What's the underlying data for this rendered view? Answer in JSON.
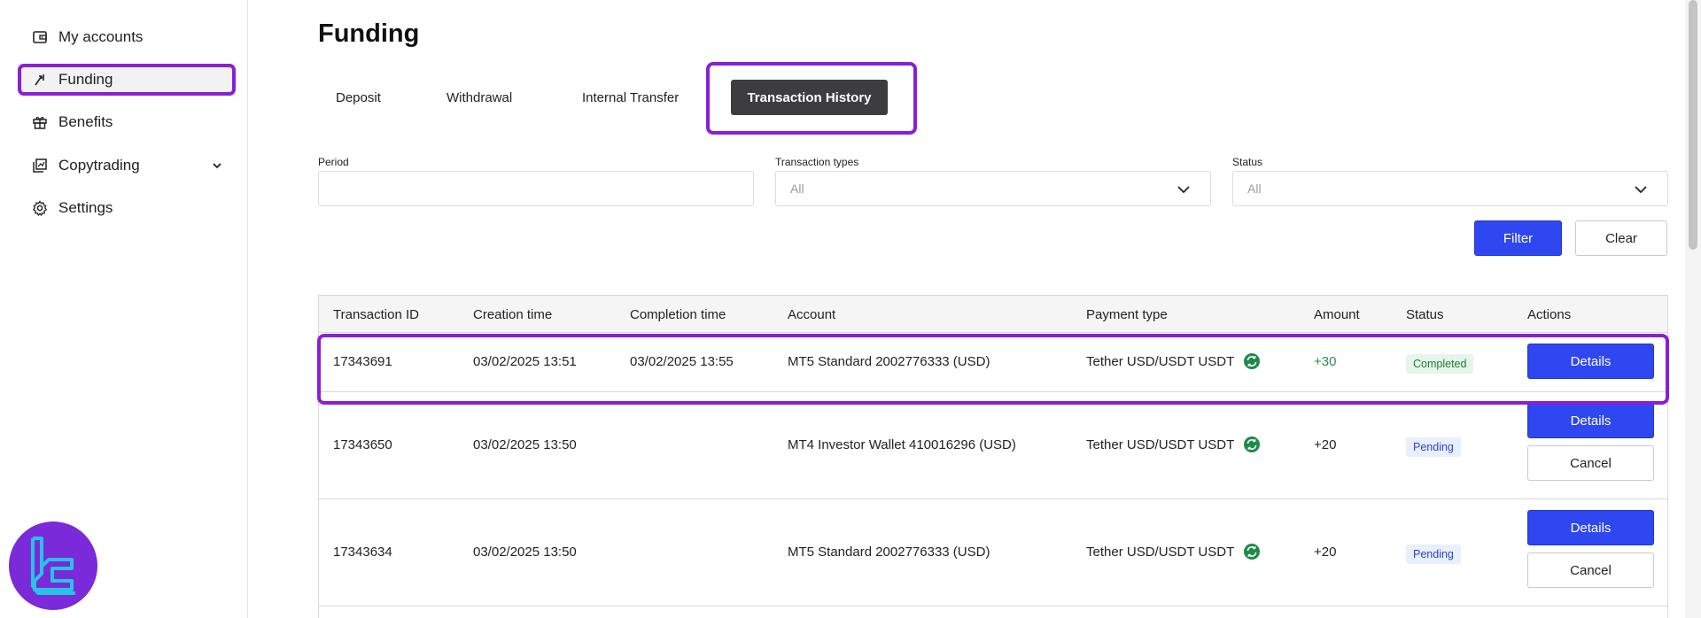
{
  "sidebar": {
    "items": [
      {
        "label": "My accounts",
        "icon": "wallet-icon"
      },
      {
        "label": "Funding",
        "icon": "funding-arrows-icon"
      },
      {
        "label": "Benefits",
        "icon": "gift-icon"
      },
      {
        "label": "Copytrading",
        "icon": "copy-icon"
      },
      {
        "label": "Settings",
        "icon": "gear-icon"
      }
    ]
  },
  "page": {
    "title": "Funding"
  },
  "tabs": [
    {
      "label": "Deposit"
    },
    {
      "label": "Withdrawal"
    },
    {
      "label": "Internal Transfer"
    },
    {
      "label": "Transaction History"
    }
  ],
  "filters": {
    "period": {
      "label": "Period",
      "value": ""
    },
    "transaction_types": {
      "label": "Transaction types",
      "value": "All"
    },
    "status": {
      "label": "Status",
      "value": "All"
    },
    "filter_label": "Filter",
    "clear_label": "Clear"
  },
  "table": {
    "headers": [
      "Transaction ID",
      "Creation time",
      "Completion time",
      "Account",
      "Payment type",
      "Amount",
      "Status",
      "Actions"
    ],
    "rows": [
      {
        "id": "17343691",
        "created": "03/02/2025 13:51",
        "completed": "03/02/2025 13:55",
        "account": "MT5 Standard 2002776333 (USD)",
        "payment": "Tether USD/USDT USDT",
        "amount": "+30",
        "status": "Completed",
        "details": "Details",
        "cancel": ""
      },
      {
        "id": "17343650",
        "created": "03/02/2025 13:50",
        "completed": "",
        "account": "MT4 Investor Wallet 410016296 (USD)",
        "payment": "Tether USD/USDT USDT",
        "amount": "+20",
        "status": "Pending",
        "details": "Details",
        "cancel": "Cancel"
      },
      {
        "id": "17343634",
        "created": "03/02/2025 13:50",
        "completed": "",
        "account": "MT5 Standard 2002776333 (USD)",
        "payment": "Tether USD/USDT USDT",
        "amount": "+20",
        "status": "Pending",
        "details": "Details",
        "cancel": "Cancel"
      }
    ]
  },
  "colors": {
    "accent": "#2f47f0",
    "highlight": "#8a1fd6",
    "tab_active": "#3d3d40",
    "amount_green": "#2f8a4b"
  }
}
